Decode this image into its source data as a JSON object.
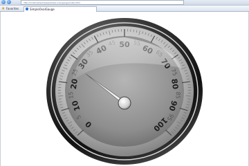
{
  "browser": {
    "address": "http://localhost/samples/simple-oval-gauge/index.html",
    "favorites_label": "Favorites",
    "tab_label": "SimpleOvalGauge"
  },
  "gauge": {
    "major_ticks": [
      "0",
      "10",
      "20",
      "30",
      "40",
      "50",
      "60",
      "70",
      "80",
      "90",
      "100"
    ],
    "minor_ticks": [
      "5",
      "15",
      "25",
      "35",
      "45",
      "55",
      "65",
      "75",
      "85",
      "95"
    ],
    "value": 31,
    "min": 0,
    "max": 100,
    "face_color": "#8e8e8e",
    "needle_color": "#f2f2f2"
  }
}
